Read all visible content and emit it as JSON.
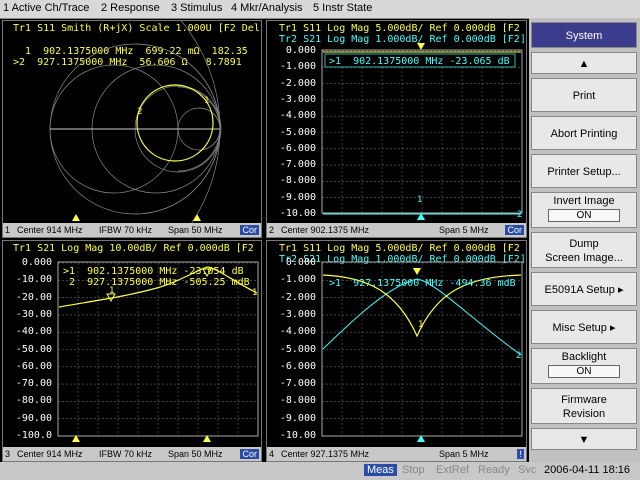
{
  "menu": [
    "1 Active Ch/Trace",
    "2 Response",
    "3 Stimulus",
    "4 Mkr/Analysis",
    "5 Instr State"
  ],
  "panels": {
    "p1": {
      "title": "Tr1 S11 Smith (R+jX) Scale 1.000U [F2 Del",
      "m1": "  1  902.1375000 MHz  699.22 mΩ  182.35",
      "m2": ">2  927.1375000 MHz  56.606 Ω   8.7891",
      "footer_num": "1",
      "footer_center": "Center 914 MHz",
      "footer_ifbw": "IFBW 70 kHz",
      "footer_span": "Span 50 MHz",
      "cor": "Cor"
    },
    "p2": {
      "title1": "Tr1 S11 Log Mag 5.000dB/ Ref 0.000dB [F2",
      "title2": "Tr2 S21 Log Mag 1.000dB/ Ref 0.000dB [F2]",
      "marker": ">1  902.1375000 MHz -23.065 dB",
      "ylabels": [
        "0.000",
        "-1.000",
        "-2.000",
        "-3.000",
        "-4.000",
        "-5.000",
        "-6.000",
        "-7.000",
        "-8.000",
        "-9.000",
        "-10.00"
      ],
      "footer_num": "2",
      "footer_center": "Center 902.1375 MHz",
      "footer_span": "Span 5 MHz",
      "cor": "Cor"
    },
    "p3": {
      "title": "Tr1 S21 Log Mag 10.00dB/ Ref 0.000dB [F2",
      "m1": ">1  902.1375000 MHz -23.054 dB",
      "m2": " 2  927.1375000 MHz -505.25 mdB",
      "ylabels": [
        "0.000",
        "-10.00",
        "-20.00",
        "-30.00",
        "-40.00",
        "-50.00",
        "-60.00",
        "-70.00",
        "-80.00",
        "-90.00",
        "-100.0"
      ],
      "footer_num": "3",
      "footer_center": "Center 914 MHz",
      "footer_ifbw": "IFBW 70 kHz",
      "footer_span": "Span 50 MHz",
      "cor": "Cor"
    },
    "p4": {
      "title1": "Tr1 S11 Log Mag 5.000dB/ Ref 0.000dB [F2",
      "title2": "Tr2 S21 Log Mag 1.000dB/ Ref 0.000dB [F2]",
      "marker": ">1  927.1375000 MHz -494.36 mdB",
      "ylabels": [
        "0.000",
        "-1.000",
        "-2.000",
        "-3.000",
        "-4.000",
        "-5.000",
        "-6.000",
        "-7.000",
        "-8.000",
        "-9.000",
        "-10.00"
      ],
      "footer_num": "4",
      "footer_center": "Center 927.1375 MHz",
      "footer_span": "Span 5 MHz",
      "cor": "!"
    }
  },
  "sidebar": {
    "header": "System",
    "print": "Print",
    "abort": "Abort Printing",
    "printer_setup": "Printer Setup...",
    "invert": "Invert Image",
    "invert_val": "ON",
    "dump1": "Dump",
    "dump2": "Screen Image...",
    "e5091": "E5091A Setup",
    "misc": "Misc Setup",
    "backlight": "Backlight",
    "backlight_val": "ON",
    "fw1": "Firmware",
    "fw2": "Revision"
  },
  "status": {
    "meas": "Meas",
    "stop": "Stop",
    "extref": "ExtRef",
    "ready": "Ready",
    "svc": "Svc",
    "datetime": "2006-04-11 18:16"
  },
  "colors": {
    "trace1": "#ffff40",
    "trace2": "#40ffff",
    "accent": "#3c3c8c"
  }
}
